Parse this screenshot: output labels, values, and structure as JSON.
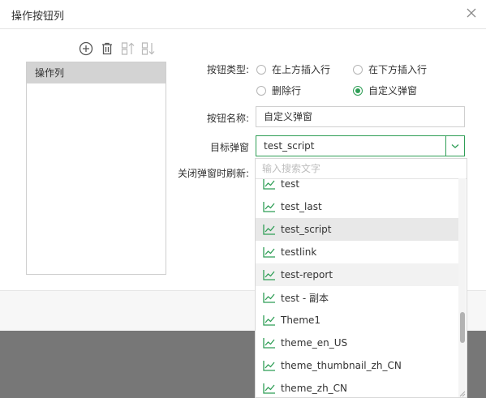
{
  "dialog": {
    "title": "操作按钮列"
  },
  "column_list": {
    "items": [
      "操作列"
    ]
  },
  "form": {
    "button_type_label": "按钮类型:",
    "button_type_options": [
      "在上方插入行",
      "在下方插入行",
      "删除行",
      "自定义弹窗"
    ],
    "button_type_selected": "自定义弹窗",
    "button_name_label": "按钮名称:",
    "button_name_value": "自定义弹窗",
    "target_popup_label": "目标弹窗",
    "target_popup_value": "test_script",
    "refresh_on_close_label": "关闭弹窗时刷新:"
  },
  "dropdown": {
    "search_placeholder": "输入搜索文字",
    "items": [
      "test",
      "test_last",
      "test_script",
      "testlink",
      "test-report",
      "test - 副本",
      "Theme1",
      "theme_en_US",
      "theme_thumbnail_zh_CN",
      "theme_zh_CN"
    ],
    "selected": "test_script",
    "hovered": "test-report",
    "scroll_position": 0.62
  },
  "colors": {
    "accent": "#2f9e56",
    "selected_row": "#e8e8e8",
    "list_header": "#d3d3d3",
    "overlay": "#777777"
  }
}
